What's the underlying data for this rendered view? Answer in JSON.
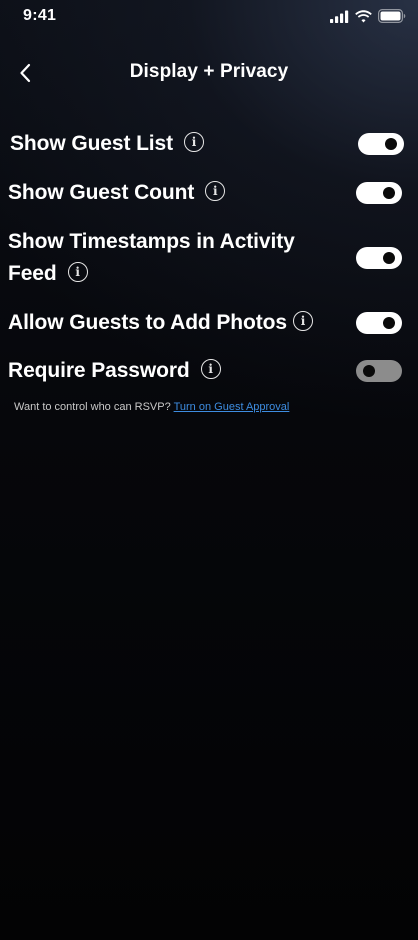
{
  "status_bar": {
    "time": "9:41",
    "icons": [
      "signal-icon",
      "wifi-icon",
      "battery-icon"
    ]
  },
  "header": {
    "back_icon": "chevron-left-icon",
    "title": "Display + Privacy"
  },
  "settings": [
    {
      "label": "Show Guest List",
      "enabled": true,
      "info_icon": "info-icon"
    },
    {
      "label": "Show Guest Count",
      "enabled": true,
      "info_icon": "info-icon"
    },
    {
      "label_line1": "Show Timestamps in Activity",
      "label_line2": "Feed",
      "enabled": true,
      "info_icon": "info-icon"
    },
    {
      "label": "Allow Guests to Add Photos",
      "enabled": true,
      "info_icon": "info-icon"
    },
    {
      "label": "Require Password",
      "enabled": false,
      "info_icon": "info-icon"
    }
  ],
  "footnote": {
    "text": "Want to control who can RSVP?",
    "link": "Turn on Guest Approval"
  },
  "colors": {
    "toggle_on": "#ffffff",
    "toggle_off": "#8c8c8c",
    "link": "#3d8ce0",
    "background_top": "#0b0e15",
    "background_bottom": "#030304"
  }
}
